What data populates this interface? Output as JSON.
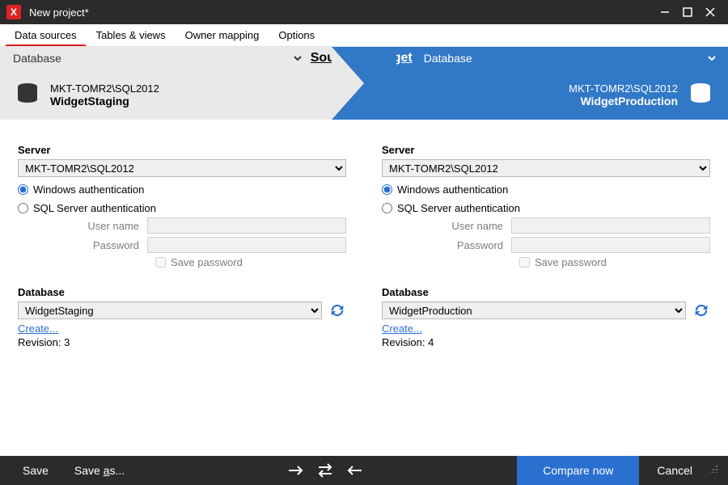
{
  "title": "New project*",
  "menu": {
    "items": [
      "Data sources",
      "Tables & views",
      "Owner mapping",
      "Options"
    ],
    "active": 0
  },
  "banner": {
    "sourceLabel": "Source",
    "targetLabel": "Target",
    "typeOptions": [
      "Database"
    ],
    "source": {
      "server": "MKT-TOMR2\\SQL2012",
      "db": "WidgetStaging"
    },
    "target": {
      "server": "MKT-TOMR2\\SQL2012",
      "db": "WidgetProduction"
    }
  },
  "form": {
    "serverLabel": "Server",
    "windowsAuth": "Windows authentication",
    "sqlAuth": "SQL Server authentication",
    "userLabel": "User name",
    "passLabel": "Password",
    "savePass": "Save password",
    "databaseLabel": "Database",
    "createLink": "Create...",
    "revisionLabel": "Revision:"
  },
  "source": {
    "server": "MKT-TOMR2\\SQL2012",
    "auth": "windows",
    "db": "WidgetStaging",
    "revision": 3
  },
  "target": {
    "server": "MKT-TOMR2\\SQL2012",
    "auth": "windows",
    "db": "WidgetProduction",
    "revision": 4
  },
  "footer": {
    "save": "Save",
    "saveAs": "Save as...",
    "compare": "Compare now",
    "cancel": "Cancel"
  }
}
